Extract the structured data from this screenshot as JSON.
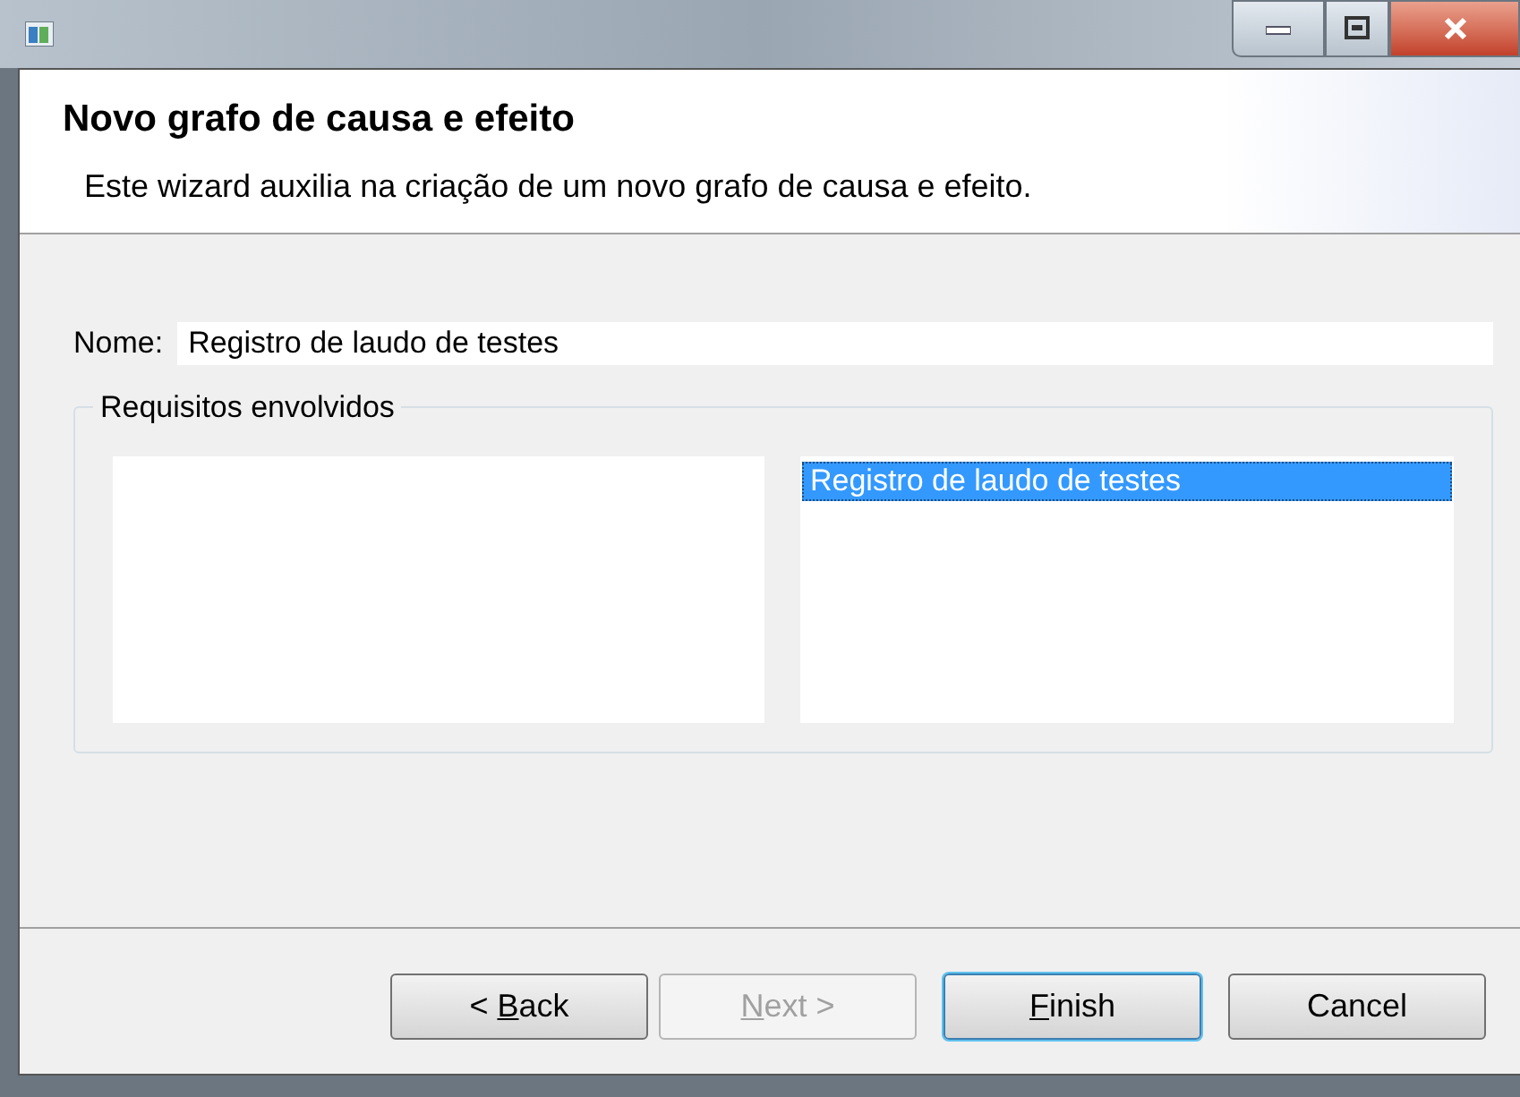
{
  "window": {
    "controls": [
      {
        "kind": "minimize"
      },
      {
        "kind": "maximize"
      },
      {
        "kind": "close"
      }
    ]
  },
  "header": {
    "title": "Novo grafo de causa e efeito",
    "description": "Este wizard auxilia na criação de um novo grafo de causa e efeito."
  },
  "name_field": {
    "label": "Nome:",
    "value": "Registro de laudo de testes"
  },
  "requirements": {
    "legend": "Requisitos envolvidos",
    "selected_list": [
      {
        "label": "Registro de laudo de testes",
        "selected": true
      }
    ]
  },
  "buttons": [
    {
      "before": "< ",
      "mnemonic": "B",
      "after": "ack",
      "disabled": false,
      "default": false
    },
    {
      "mnemonic": "N",
      "after": "ext >",
      "disabled": true,
      "default": false
    },
    {
      "mnemonic": "F",
      "after": "inish",
      "disabled": false,
      "default": true
    },
    {
      "before": "Cancel",
      "disabled": false,
      "default": false
    }
  ]
}
